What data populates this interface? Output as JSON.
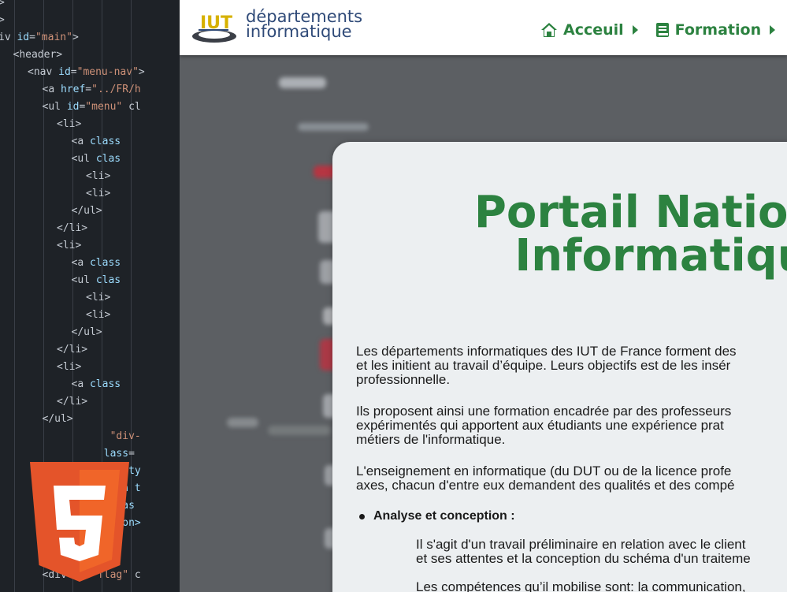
{
  "editor": {
    "lines": [
      {
        "indent": 0,
        "tokens": [
          {
            "t": "tag",
            "v": ">"
          }
        ]
      },
      {
        "indent": 0,
        "tokens": [
          {
            "t": "tag",
            "v": ">"
          }
        ]
      },
      {
        "indent": 0,
        "tokens": [
          {
            "t": "tag",
            "v": "iv "
          },
          {
            "t": "attr",
            "v": "id"
          },
          {
            "t": "tag",
            "v": "="
          },
          {
            "t": "str",
            "v": "\"main\""
          },
          {
            "t": "tag",
            "v": ">"
          }
        ]
      },
      {
        "indent": 1,
        "tokens": [
          {
            "t": "tag",
            "v": "<header>"
          }
        ]
      },
      {
        "indent": 2,
        "tokens": [
          {
            "t": "tag",
            "v": "<nav "
          },
          {
            "t": "attr",
            "v": "id"
          },
          {
            "t": "tag",
            "v": "="
          },
          {
            "t": "str",
            "v": "\"menu-nav\""
          },
          {
            "t": "tag",
            "v": ">"
          }
        ]
      },
      {
        "indent": 3,
        "tokens": [
          {
            "t": "tag",
            "v": "<a "
          },
          {
            "t": "attr",
            "v": "href"
          },
          {
            "t": "tag",
            "v": "="
          },
          {
            "t": "str",
            "v": "\"../FR/h"
          }
        ]
      },
      {
        "indent": 3,
        "tokens": [
          {
            "t": "tag",
            "v": "<ul "
          },
          {
            "t": "attr",
            "v": "id"
          },
          {
            "t": "tag",
            "v": "="
          },
          {
            "t": "str",
            "v": "\"menu\""
          },
          {
            "t": "tag",
            "v": " cl"
          }
        ]
      },
      {
        "indent": 4,
        "tokens": [
          {
            "t": "tag",
            "v": "<li>"
          }
        ]
      },
      {
        "indent": 5,
        "tokens": [
          {
            "t": "tag",
            "v": "<a "
          },
          {
            "t": "attr",
            "v": "class"
          }
        ]
      },
      {
        "indent": 5,
        "tokens": [
          {
            "t": "tag",
            "v": "<ul "
          },
          {
            "t": "attr",
            "v": "clas"
          }
        ]
      },
      {
        "indent": 6,
        "tokens": [
          {
            "t": "tag",
            "v": "<li>"
          }
        ]
      },
      {
        "indent": 6,
        "tokens": [
          {
            "t": "tag",
            "v": "<li>"
          }
        ]
      },
      {
        "indent": 5,
        "tokens": [
          {
            "t": "tag",
            "v": "</ul>"
          }
        ]
      },
      {
        "indent": 4,
        "tokens": [
          {
            "t": "tag",
            "v": "</li>"
          }
        ]
      },
      {
        "indent": 4,
        "tokens": [
          {
            "t": "tag",
            "v": "<li>"
          }
        ]
      },
      {
        "indent": 5,
        "tokens": [
          {
            "t": "tag",
            "v": "<a "
          },
          {
            "t": "attr",
            "v": "class"
          }
        ]
      },
      {
        "indent": 5,
        "tokens": [
          {
            "t": "tag",
            "v": "<ul "
          },
          {
            "t": "attr",
            "v": "clas"
          }
        ]
      },
      {
        "indent": 6,
        "tokens": [
          {
            "t": "tag",
            "v": "<li>"
          }
        ]
      },
      {
        "indent": 6,
        "tokens": [
          {
            "t": "tag",
            "v": "<li>"
          }
        ]
      },
      {
        "indent": 5,
        "tokens": [
          {
            "t": "tag",
            "v": "</ul>"
          }
        ]
      },
      {
        "indent": 4,
        "tokens": [
          {
            "t": "tag",
            "v": "</li>"
          }
        ]
      },
      {
        "indent": 4,
        "tokens": [
          {
            "t": "tag",
            "v": "<li>"
          }
        ]
      },
      {
        "indent": 5,
        "tokens": [
          {
            "t": "tag",
            "v": "<a "
          },
          {
            "t": "attr",
            "v": "class"
          }
        ]
      },
      {
        "indent": 4,
        "tokens": [
          {
            "t": "tag",
            "v": "</li>"
          }
        ]
      },
      {
        "indent": 3,
        "tokens": [
          {
            "t": "tag",
            "v": "</ul>"
          }
        ]
      },
      {
        "indent": 3,
        "tokens": [
          {
            "t": "tag",
            "v": "           "
          },
          {
            "t": "str",
            "v": "\"div-"
          }
        ]
      },
      {
        "indent": 3,
        "tokens": [
          {
            "t": "tag",
            "v": "          "
          },
          {
            "t": "attr",
            "v": "lass"
          },
          {
            "t": "tag",
            "v": "="
          }
        ]
      },
      {
        "indent": 3,
        "tokens": [
          {
            "t": "tag",
            "v": "          "
          },
          {
            "t": "attr",
            "v": "put ty"
          }
        ]
      },
      {
        "indent": 3,
        "tokens": [
          {
            "t": "tag",
            "v": "          "
          },
          {
            "t": "attr",
            "v": "tton t"
          }
        ]
      },
      {
        "indent": 3,
        "tokens": [
          {
            "t": "tag",
            "v": "          "
          },
          {
            "t": "attr",
            "v": " clas"
          }
        ]
      },
      {
        "indent": 3,
        "tokens": [
          {
            "t": "tag",
            "v": "          "
          },
          {
            "t": "attr",
            "v": "utton>"
          }
        ]
      },
      {
        "indent": 3,
        "tokens": [
          {
            "t": "tag",
            "v": "            >"
          }
        ]
      },
      {
        "indent": 3,
        "tokens": [
          {
            "t": "tag",
            "v": "          v>"
          }
        ]
      },
      {
        "indent": 3,
        "tokens": [
          {
            "t": "tag",
            "v": "<div "
          },
          {
            "t": "attr",
            "v": "id"
          },
          {
            "t": "tag",
            "v": "="
          },
          {
            "t": "str",
            "v": "\"flag\""
          },
          {
            "t": "tag",
            "v": " c"
          }
        ]
      }
    ],
    "html5_logo_text": "5"
  },
  "site": {
    "logo": {
      "mark_text": "IUT",
      "line1": "départements",
      "line2": "informatique"
    },
    "nav": [
      {
        "label": "Acceuil",
        "icon": "home-icon"
      },
      {
        "label": "Formation",
        "icon": "book-icon"
      }
    ],
    "title": "Portail Nationa\nInformatiqu",
    "paragraphs": {
      "p1": "Les départements informatiques des IUT de France forment des\net les initient au travail d’équipe. Leurs objectifs est de les insér\nprofessionnelle.",
      "p2": "Ils proposent ainsi une formation encadrée par des professeurs\nexpérimentés qui apportent aux étudiants une expérience prat\nmétiers de l'informatique.",
      "p3": "L'enseignement en informatique (du DUT ou de la licence profe\naxes, chacun d'entre eux demandent des qualités et des compé",
      "bullet": "Analyse et conception :",
      "p4": "Il s'agit d'un travail préliminaire en relation avec le client\net ses attentes et la conception du schéma d'un traiteme",
      "p5": "Les compétences qu’il mobilise sont: la communication,"
    },
    "colors": {
      "brand_green": "#2c8240",
      "logo_blue": "#2f4a78",
      "card_bg": "#eceff1"
    }
  }
}
